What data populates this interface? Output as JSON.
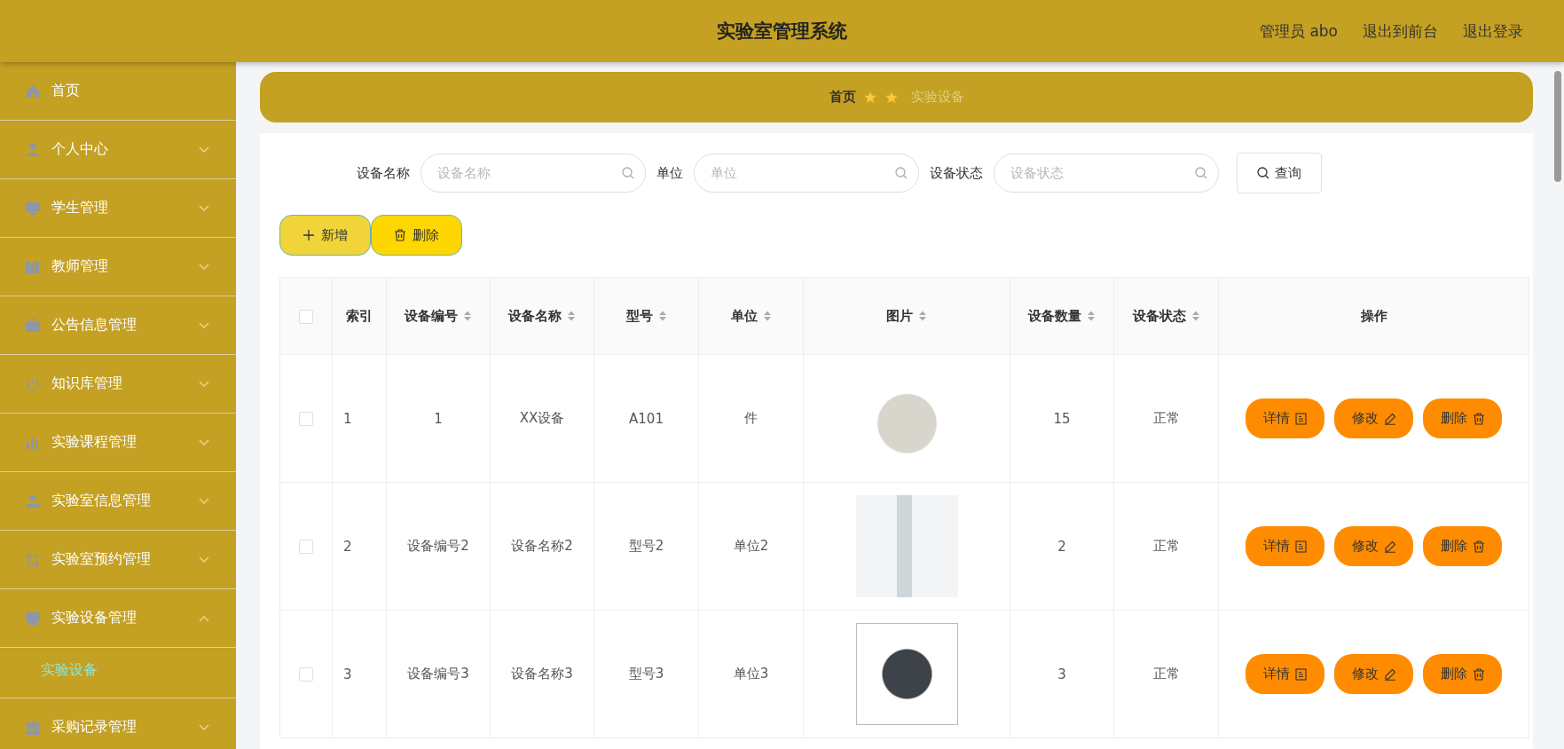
{
  "header": {
    "title": "实验室管理系统",
    "links": [
      "管理员 abo",
      "退出到前台",
      "退出登录"
    ]
  },
  "sidebar": {
    "items": [
      {
        "label": "首页",
        "kind": "link"
      },
      {
        "label": "个人中心",
        "kind": "menu",
        "expanded": false
      },
      {
        "label": "学生管理",
        "kind": "menu",
        "expanded": false
      },
      {
        "label": "教师管理",
        "kind": "menu",
        "expanded": false
      },
      {
        "label": "公告信息管理",
        "kind": "menu",
        "expanded": false
      },
      {
        "label": "知识库管理",
        "kind": "menu",
        "expanded": false
      },
      {
        "label": "实验课程管理",
        "kind": "menu",
        "expanded": false
      },
      {
        "label": "实验室信息管理",
        "kind": "menu",
        "expanded": false
      },
      {
        "label": "实验室预约管理",
        "kind": "menu",
        "expanded": false
      },
      {
        "label": "实验设备管理",
        "kind": "menu",
        "expanded": true,
        "children": [
          {
            "label": "实验设备",
            "selected": true
          }
        ]
      },
      {
        "label": "采购记录管理",
        "kind": "menu",
        "expanded": false
      }
    ]
  },
  "breadcrumb": {
    "home": "首页",
    "current": "实验设备"
  },
  "search": {
    "fields": [
      {
        "label": "设备名称",
        "placeholder": "设备名称"
      },
      {
        "label": "单位",
        "placeholder": "单位"
      },
      {
        "label": "设备状态",
        "placeholder": "设备状态"
      }
    ],
    "button": "查询"
  },
  "toolbar": [
    {
      "label": "新增",
      "kind": "add"
    },
    {
      "label": "删除",
      "kind": "delete"
    }
  ],
  "table": {
    "all_checked": false,
    "columns": [
      {
        "label": "索引",
        "sortable": false
      },
      {
        "label": "设备编号",
        "sortable": true
      },
      {
        "label": "设备名称",
        "sortable": true
      },
      {
        "label": "型号",
        "sortable": true
      },
      {
        "label": "单位",
        "sortable": true
      },
      {
        "label": "图片",
        "sortable": true
      },
      {
        "label": "设备数量",
        "sortable": true
      },
      {
        "label": "设备状态",
        "sortable": true
      },
      {
        "label": "操作",
        "sortable": false
      }
    ],
    "rows": [
      {
        "checked": false,
        "index": "1",
        "code": "1",
        "name": "XX设备",
        "model": "A101",
        "unit": "件",
        "quantity": "15",
        "status": "正常",
        "actions": [
          {
            "label": "详情",
            "kind": "detail"
          },
          {
            "label": "修改",
            "kind": "edit"
          },
          {
            "label": "删除",
            "kind": "delete"
          }
        ]
      },
      {
        "checked": false,
        "index": "2",
        "code": "设备编号2",
        "name": "设备名称2",
        "model": "型号2",
        "unit": "单位2",
        "quantity": "2",
        "status": "正常",
        "actions": [
          {
            "label": "详情",
            "kind": "detail"
          },
          {
            "label": "修改",
            "kind": "edit"
          },
          {
            "label": "删除",
            "kind": "delete"
          }
        ]
      },
      {
        "checked": false,
        "index": "3",
        "code": "设备编号3",
        "name": "设备名称3",
        "model": "型号3",
        "unit": "单位3",
        "quantity": "3",
        "status": "正常",
        "actions": [
          {
            "label": "详情",
            "kind": "detail"
          },
          {
            "label": "修改",
            "kind": "edit"
          },
          {
            "label": "删除",
            "kind": "delete"
          }
        ]
      }
    ]
  }
}
